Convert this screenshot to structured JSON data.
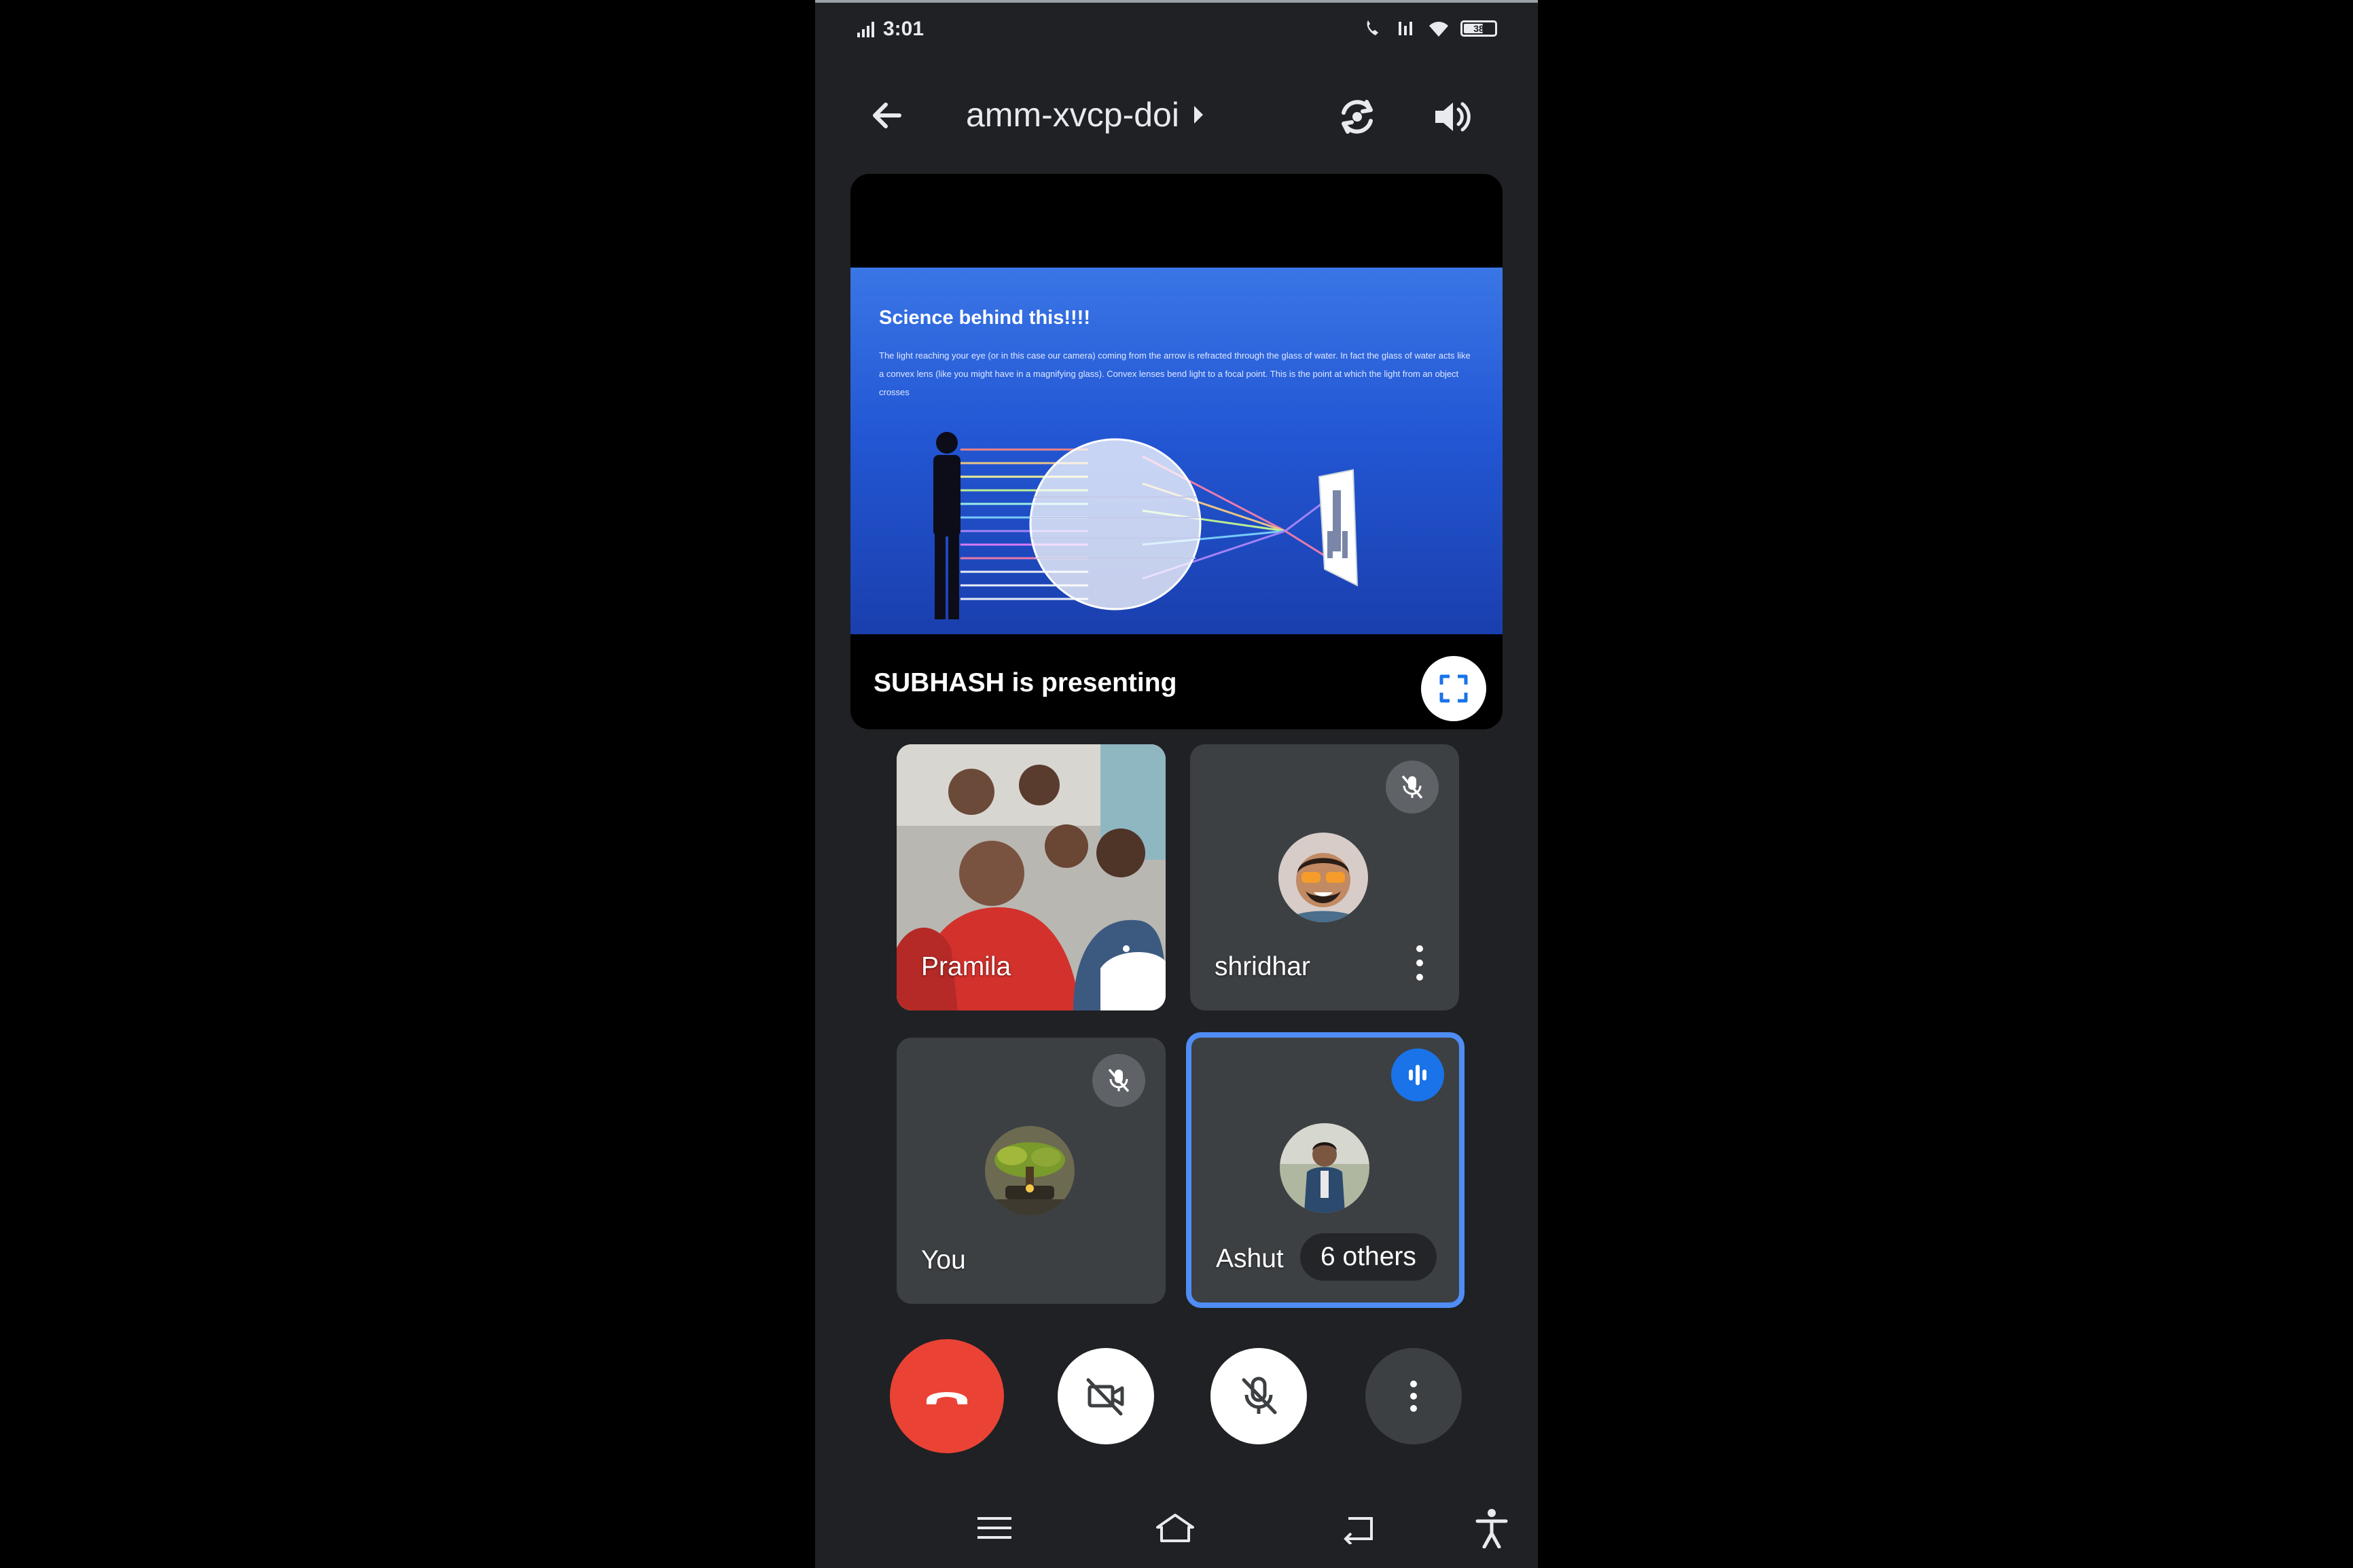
{
  "status_bar": {
    "time": "3:01",
    "battery": "38"
  },
  "top_bar": {
    "meeting_code": "amm-xvcp-doi"
  },
  "presentation": {
    "slide_title": "Science behind this!!!!",
    "slide_body": "The light reaching your eye (or in this case our camera) coming from the arrow is refracted through the glass of water. In fact the glass of water acts like a convex lens (like you might have in a magnifying glass). Convex lenses bend light to a focal point. This is the point at which the light from an object crosses",
    "presenter_label": "SUBHASH is presenting"
  },
  "tiles": [
    {
      "name": "Pramila",
      "muted": false,
      "speaking": false
    },
    {
      "name": "shridhar",
      "muted": true,
      "speaking": false
    },
    {
      "name": "You",
      "muted": true,
      "speaking": false
    },
    {
      "name": "Ashut",
      "muted": false,
      "speaking": true,
      "others_label": "6 others"
    }
  ],
  "colors": {
    "end_call": "#ea4335",
    "speaking": "#1a73e8",
    "background": "#202124",
    "tile": "#3c4043"
  },
  "icons": {
    "back": "arrow-left",
    "flip_camera": "camera-flip",
    "speaker": "volume",
    "fullscreen": "fullscreen",
    "end_call": "phone-hangup",
    "camera_off": "videocam-off",
    "mic_off": "mic-off",
    "more": "more-vertical",
    "nav_menu": "menu",
    "nav_home": "home",
    "nav_back": "back",
    "accessibility": "accessibility"
  }
}
